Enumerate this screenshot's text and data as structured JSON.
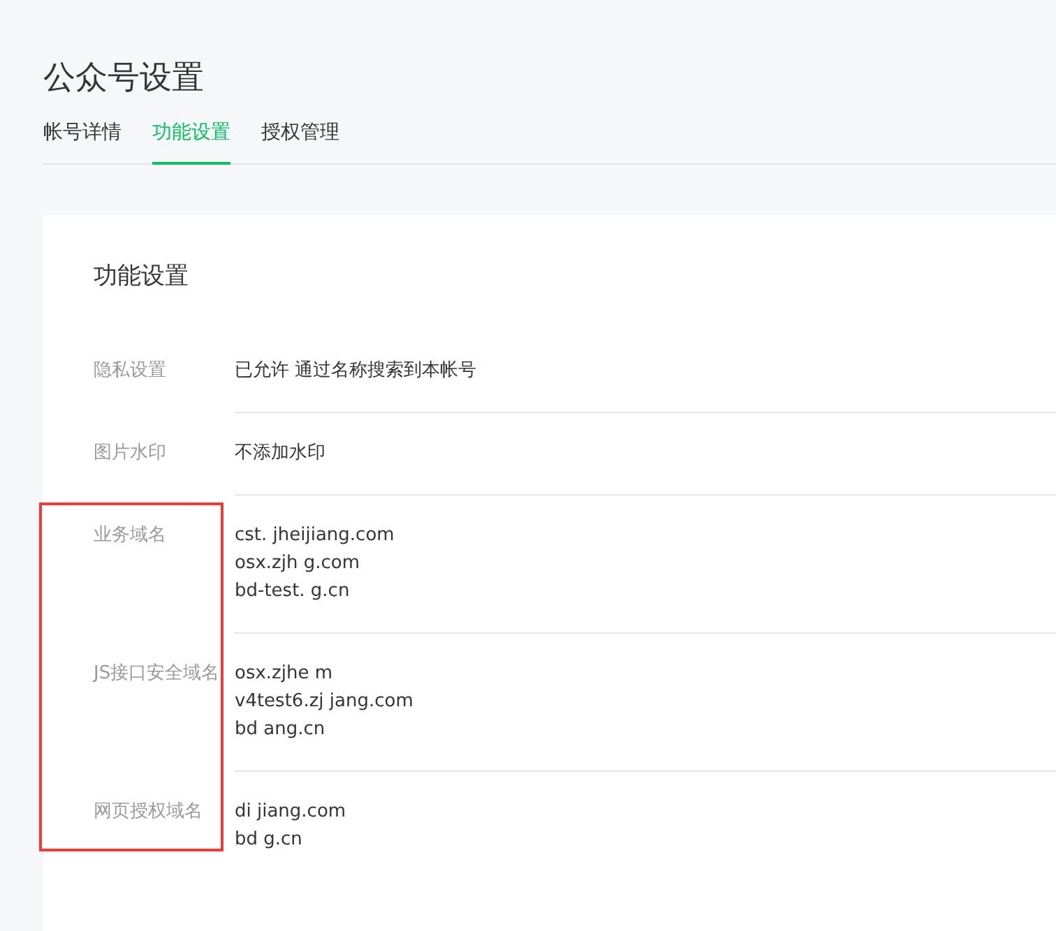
{
  "page_title": "公众号设置",
  "tabs": [
    {
      "label": "帐号详情",
      "selected": false
    },
    {
      "label": "功能设置",
      "selected": true
    },
    {
      "label": "授权管理",
      "selected": false
    }
  ],
  "card": {
    "title": "功能设置",
    "rows": [
      {
        "label": "隐私设置",
        "values": [
          "已允许 通过名称搜索到本帐号"
        ]
      },
      {
        "label": "图片水印",
        "values": [
          "不添加水印"
        ]
      },
      {
        "label": "业务域名",
        "values": [
          "cst. jheijiang.com",
          "osx.zjh g.com",
          "bd-test. g.cn"
        ]
      },
      {
        "label": "JS接口安全域名",
        "values": [
          "osx.zjhe m",
          "v4test6.zj jang.com",
          "bd ang.cn"
        ]
      },
      {
        "label": "网页授权域名",
        "values": [
          "di jiang.com",
          "bd g.cn"
        ]
      }
    ]
  },
  "highlight": {
    "color": "#f03a3a"
  }
}
